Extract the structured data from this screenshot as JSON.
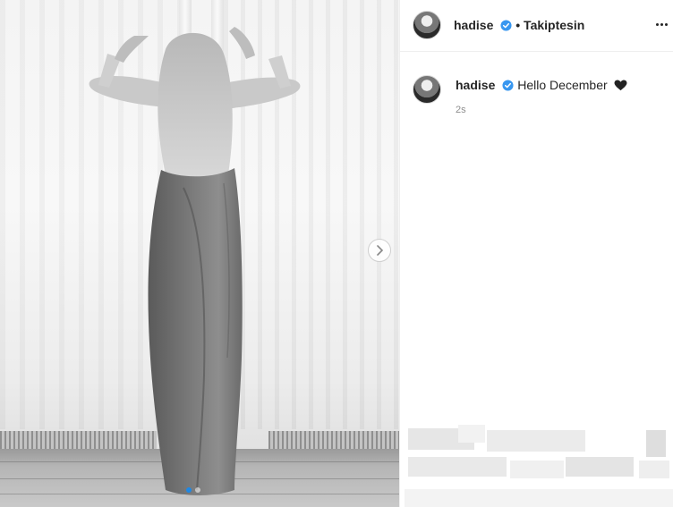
{
  "post": {
    "author": {
      "username": "hadise",
      "verified": true,
      "follow_label": "• Takiptesin"
    },
    "caption": {
      "username": "hadise",
      "text": "Hello December",
      "emoji": "black-heart"
    },
    "timestamp": "2s",
    "carousel": {
      "total_images": 2,
      "current_index": 1
    },
    "icons": {
      "verified": "verified-badge-icon",
      "next": "chevron-right-icon",
      "more": "more-options-icon"
    },
    "colors": {
      "verified_blue": "#3897f0",
      "active_dot": "#1e88e5",
      "text_primary": "#262626",
      "text_secondary": "#8e8e8e"
    }
  }
}
